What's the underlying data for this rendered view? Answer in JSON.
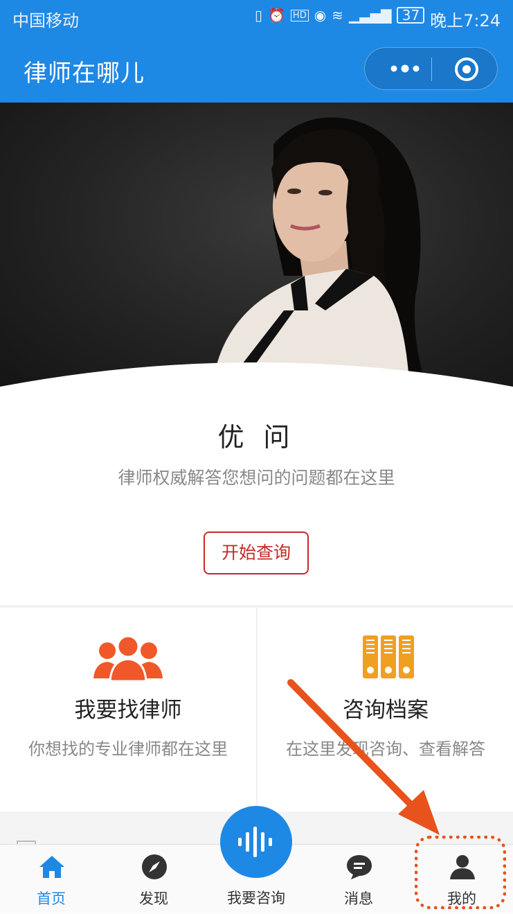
{
  "status_bar": {
    "carrier": "中国移动",
    "battery": "37",
    "time": "晚上7:24",
    "icons": [
      "vibrate-icon",
      "alarm-icon",
      "hd-icon",
      "eye-icon",
      "wifi-icon",
      "signal-4g-icon"
    ]
  },
  "title_bar": {
    "title": "律师在哪儿",
    "color": "#1e88e5"
  },
  "card": {
    "title": "优 问",
    "subtitle": "律师权威解答您想问的问题都在这里",
    "start_button": "开始查询"
  },
  "features": [
    {
      "title": "我要找律师",
      "desc": "你想找的专业律师都在这里",
      "icon": "lawyers-group-icon",
      "color": "#f0582a"
    },
    {
      "title": "咨询档案",
      "desc": "在这里发现咨询、查看解答",
      "icon": "archive-binders-icon",
      "color": "#f0a020"
    }
  ],
  "tabbar": {
    "tabs": [
      {
        "label": "首页",
        "icon": "home-icon",
        "active": true
      },
      {
        "label": "发现",
        "icon": "compass-icon",
        "active": false
      },
      {
        "label": "我要咨询",
        "icon": "voice-icon",
        "active": false
      },
      {
        "label": "消息",
        "icon": "message-icon",
        "active": false
      },
      {
        "label": "我的",
        "icon": "user-icon",
        "active": false
      }
    ]
  },
  "annotation": {
    "highlight": "我的",
    "color": "#e8521c"
  }
}
